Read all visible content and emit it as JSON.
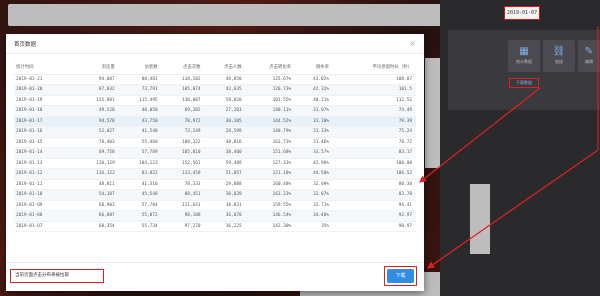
{
  "header": {
    "date_value": "2019-01-07"
  },
  "sidebar_buttons": [
    {
      "icon": "chart-icon",
      "label": "统计数据"
    },
    {
      "icon": "link-icon",
      "label": "链接"
    },
    {
      "icon": "edit-icon",
      "label": "编辑"
    }
  ],
  "sidebar_link": "下载数据",
  "modal": {
    "title": "首页数据",
    "close_glyph": "×",
    "columns": [
      "统计时间",
      "浏览量",
      "访客数",
      "点击次数",
      "点击人数",
      "点击转化率",
      "跳失率",
      "平均停留时长（秒）"
    ],
    "rows": [
      [
        "2019-01-21",
        "94,087",
        "80,481",
        "118,182",
        "48,850",
        "125.67%",
        "43.02%",
        "108.87"
      ],
      [
        "2019-01-20",
        "87,032",
        "73,791",
        "105,074",
        "42,635",
        "120.73%",
        "42.32%",
        "101.5"
      ],
      [
        "2019-01-19",
        "135,881",
        "115,495",
        "138,087",
        "58,820",
        "101.55%",
        "48.21%",
        "112.52"
      ],
      [
        "2019-01-18",
        "49,520",
        "40,050",
        "69,382",
        "27,281",
        "140.11%",
        "31.07%",
        "74.49"
      ],
      [
        "2019-01-17",
        "94,570",
        "43,750",
        "78,972",
        "30,105",
        "144.52%",
        "31.10%",
        "79.39"
      ],
      [
        "2019-01-16",
        "52,027",
        "41,548",
        "73,249",
        "28,599",
        "140.79%",
        "31.33%",
        "75.24"
      ],
      [
        "2019-01-15",
        "78,403",
        "55,468",
        "108,322",
        "38,016",
        "163.73%",
        "31.46%",
        "78.72"
      ],
      [
        "2019-01-14",
        "69,758",
        "57,769",
        "105,010",
        "38,400",
        "151.68%",
        "33.57%",
        "83.17"
      ],
      [
        "2019-01-13",
        "120,129",
        "104,123",
        "152,561",
        "59,489",
        "127.33%",
        "42.96%",
        "108.08"
      ],
      [
        "2019-01-12",
        "116,122",
        "83,022",
        "133,459",
        "51,857",
        "121.18%",
        "44.50%",
        "106.52"
      ],
      [
        "2019-01-11",
        "48,811",
        "41,310",
        "78,333",
        "29,088",
        "160.48%",
        "32.09%",
        "80.38"
      ],
      [
        "2019-01-10",
        "54,187",
        "45,540",
        "88,451",
        "30,839",
        "163.23%",
        "32.07%",
        "83.78"
      ],
      [
        "2019-01-09",
        "68,903",
        "57,704",
        "111,641",
        "38,831",
        "159.55%",
        "32.71%",
        "94.41"
      ],
      [
        "2019-01-08",
        "66,887",
        "55,072",
        "98,108",
        "36,070",
        "146.54%",
        "34.48%",
        "92.97"
      ],
      [
        "2019-01-07",
        "68,354",
        "55,734",
        "97,270",
        "36,225",
        "142.30%",
        "35%",
        "90.97"
      ]
    ],
    "footer_note": "当前页面点击分布将被拉取",
    "download_label": "下载"
  },
  "colors": {
    "accent": "#2f8de4",
    "highlight": "#e02020"
  }
}
